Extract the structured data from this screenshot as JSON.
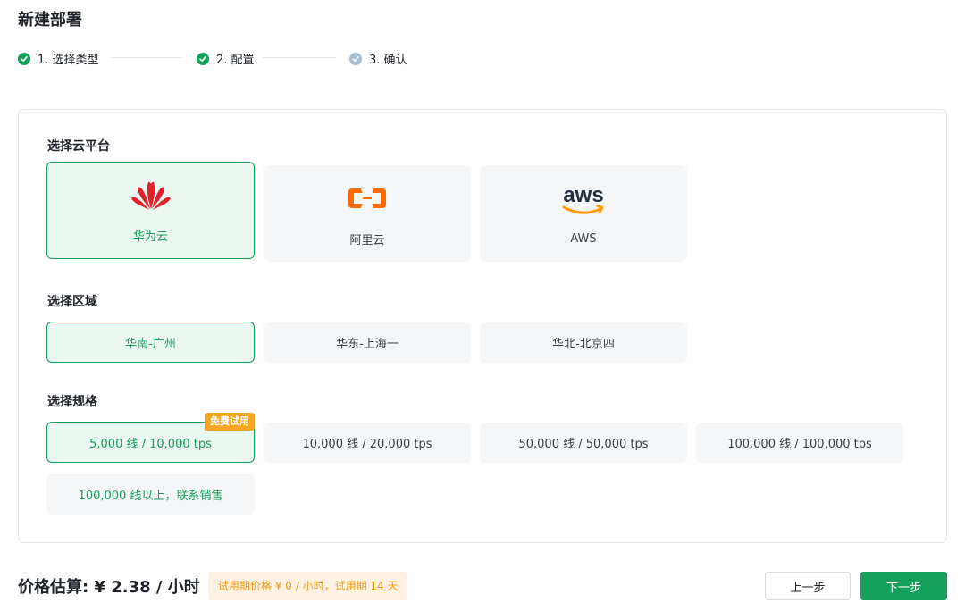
{
  "page": {
    "title": "新建部署"
  },
  "steps": [
    {
      "label": "1. 选择类型",
      "status": "done"
    },
    {
      "label": "2. 配置",
      "status": "done"
    },
    {
      "label": "3. 确认",
      "status": "pending"
    }
  ],
  "platform": {
    "title": "选择云平台",
    "options": [
      {
        "label": "华为云",
        "icon": "huawei-logo-icon",
        "selected": true
      },
      {
        "label": "阿里云",
        "icon": "aliyun-logo-icon",
        "selected": false
      },
      {
        "label": "AWS",
        "icon": "aws-logo-icon",
        "logo_text": "aws",
        "selected": false
      }
    ]
  },
  "region": {
    "title": "选择区域",
    "options": [
      {
        "label": "华南-广州",
        "selected": true
      },
      {
        "label": "华东-上海一",
        "selected": false
      },
      {
        "label": "华北-北京四",
        "selected": false
      }
    ]
  },
  "spec": {
    "title": "选择规格",
    "options": [
      {
        "label": "5,000 线 / 10,000 tps",
        "selected": true,
        "badge": "免费试用"
      },
      {
        "label": "10,000 线 / 20,000 tps",
        "selected": false
      },
      {
        "label": "50,000 线 / 50,000 tps",
        "selected": false
      },
      {
        "label": "100,000 线 / 100,000 tps",
        "selected": false
      },
      {
        "label": "100,000 线以上，联系销售",
        "selected": false,
        "highlight": true
      }
    ]
  },
  "footer": {
    "price_label": "价格估算: ¥ 2.38 / 小时",
    "trial_note": "试用期价格 ¥ 0 / 小时，试用期 14 天",
    "prev_label": "上一步",
    "next_label": "下一步"
  },
  "colors": {
    "accent": "#14a05a",
    "huawei_red": "#e3202a",
    "aliyun_orange": "#ff6a00",
    "aws_orange": "#ff9900",
    "badge_orange": "#f5a623",
    "note_bg": "#fdf1e1",
    "note_text": "#f39b12"
  }
}
